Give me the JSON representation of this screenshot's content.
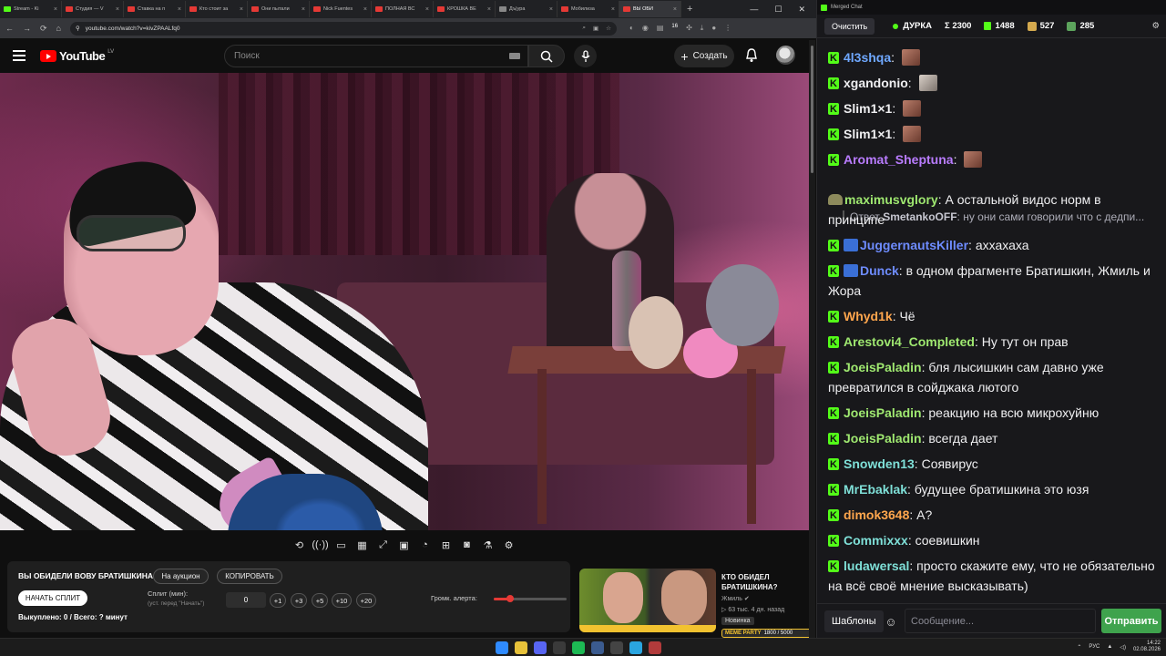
{
  "browser": {
    "tabs": [
      {
        "label": "Stream - Ki",
        "color": "#53fc18"
      },
      {
        "label": "Студия — V",
        "color": "#e53935"
      },
      {
        "label": "Ставка на п",
        "color": "#e53935"
      },
      {
        "label": "Кто стоит за",
        "color": "#e53935"
      },
      {
        "label": "Они пытали",
        "color": "#e53935"
      },
      {
        "label": "Nick Fuentes",
        "color": "#e53935"
      },
      {
        "label": "ПОЛНАЯ ВС",
        "color": "#e53935"
      },
      {
        "label": "КРОШКА ВЕ",
        "color": "#e53935"
      },
      {
        "label": "Дъ|ура",
        "color": "#888888"
      },
      {
        "label": "Мобилиза",
        "color": "#e53935"
      },
      {
        "label": "ВЫ ОБИ",
        "color": "#e53935",
        "active": true
      }
    ],
    "url": "youtube.com/watch?v=kivZPAALfq0",
    "ext_badge": "16"
  },
  "youtube": {
    "logo_text": "YouTube",
    "country": "LV",
    "search_placeholder": "Поиск",
    "create_label": "Создать"
  },
  "helper": {
    "title": "ВЫ ОБИДЕЛИ ВОВУ БРАТИШКИНА",
    "auction_label": "На аукцион",
    "copy_label": "КОПИРОВАТЬ",
    "start_split_label": "НАЧАТЬ СПЛИТ",
    "split_label": "Сплит (мин):",
    "split_hint": "(уст. перед \"Начать\")",
    "split_value": "0",
    "increments": [
      "+1",
      "+3",
      "+5",
      "+10",
      "+20"
    ],
    "volume_label": "Громк. алерта:",
    "volume_level": 0.22,
    "footer": "Выкуплено: 0 / Всего: ? минут"
  },
  "recommendation": {
    "title": "КТО ОБИДЕЛ БРАТИШКИНА?",
    "channel": "Жмиль",
    "meta": "▷ 63 тыс.  4 дн. назад",
    "badge": "Новинка",
    "meme_label": "MEME PARTY",
    "meme_value": "1800 / 5000"
  },
  "chat": {
    "window_title": "Merged Chat",
    "clear_label": "Очистить",
    "channel": "ДУРКА",
    "total": "Σ 2300",
    "kick_count": "1488",
    "twitch_count": "527",
    "vk_count": "285",
    "templates_label": "Шаблоны",
    "input_placeholder": "Сообщение...",
    "send_label": "Отправить",
    "reply": {
      "prefix": "Ответ",
      "user": "SmetankoOFF",
      "text": ": ну они сами говорили что с дедпи..."
    },
    "messages": [
      {
        "user": "4l3shqa",
        "color": "#6fa8ff",
        "text": "",
        "emote": "brown"
      },
      {
        "user": "xgandonio",
        "color": "#efeff1",
        "text": "",
        "emote": "cat"
      },
      {
        "user": "Slim1×1",
        "color": "#efeff1",
        "text": "",
        "emote": "brown"
      },
      {
        "user": "Slim1×1",
        "color": "#efeff1",
        "text": "",
        "emote": "brown"
      },
      {
        "user": "Aromat_Sheptuna",
        "color": "#b97cff",
        "text": "",
        "emote": "brown"
      },
      {
        "user": "maximusvglory",
        "color": "#9fe870",
        "text": "А остальной видос норм в принципе",
        "badge": "s"
      },
      {
        "user": "JuggernautsKiller",
        "color": "#6e8cff",
        "text": "аххахаха",
        "badge": "b"
      },
      {
        "user": "Dunck",
        "color": "#6e8cff",
        "text": "в одном фрагменте Братишкин, Жмиль и Жора",
        "badge": "b"
      },
      {
        "user": "Whyd1k",
        "color": "#ffa64d",
        "text": "Чё"
      },
      {
        "user": "Arestovi4_Completed",
        "color": "#9fe870",
        "text": "Ну тут он прав"
      },
      {
        "user": "JoeisPaladin",
        "color": "#9fe870",
        "text": "бля лысишкин сам давно уже превратился в сойджака лютого"
      },
      {
        "user": "JoeisPaladin",
        "color": "#9fe870",
        "text": "реакцию на всю микрохуйню"
      },
      {
        "user": "JoeisPaladin",
        "color": "#9fe870",
        "text": "всегда дает"
      },
      {
        "user": "Snowden13",
        "color": "#7fe0d8",
        "text": "Соявирус"
      },
      {
        "user": "MrEbaklak",
        "color": "#7fe0d8",
        "text": "будущее братишкина это юзя"
      },
      {
        "user": "dimok3648",
        "color": "#ffa64d",
        "text": "А?"
      },
      {
        "user": "Commixxx",
        "color": "#7fe0d8",
        "text": "соевишкин"
      },
      {
        "user": "ludawersal",
        "color": "#7fe0d8",
        "text": "просто скажите ему, что не обязательно на всё своё мнение высказывать)"
      }
    ]
  },
  "taskbar": {
    "lang": "РУС",
    "time": "14:22",
    "date": "02.08.2026"
  }
}
